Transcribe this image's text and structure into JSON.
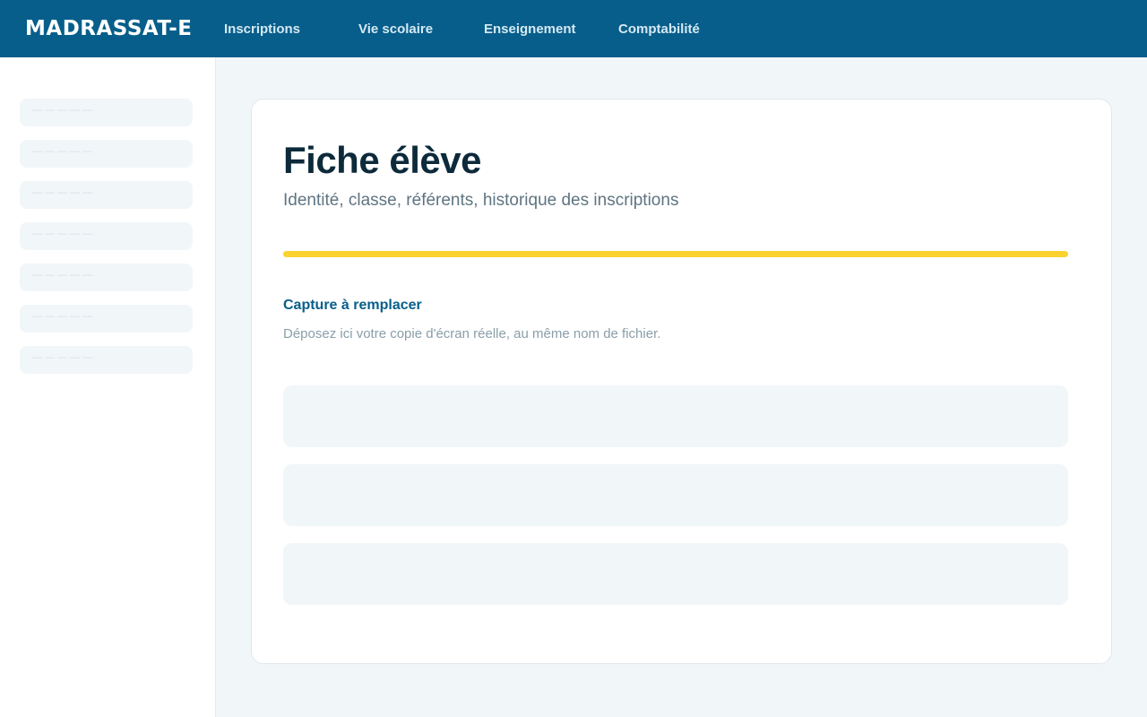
{
  "header": {
    "brand": "MADRASSAT-E",
    "nav": [
      "Inscriptions",
      "Vie scolaire",
      "Enseignement",
      "Comptabilité"
    ]
  },
  "sidebar": {
    "items": [
      {
        "label": "— — — — —"
      },
      {
        "label": "— — — — —"
      },
      {
        "label": "— — — — —"
      },
      {
        "label": "— — — — —"
      },
      {
        "label": "— — — — —"
      },
      {
        "label": "— — — — —"
      },
      {
        "label": "— — — — —"
      }
    ]
  },
  "main": {
    "title": "Fiche élève",
    "subtitle": "Identité, classe, référents, historique des inscriptions",
    "capture_title": "Capture à remplacer",
    "capture_text": "Déposez ici votre copie d'écran réelle, au même nom de fichier."
  },
  "colors": {
    "header_bg": "#075e8b",
    "accent_bar": "#fbd22e",
    "page_bg": "#f1f6f9"
  }
}
